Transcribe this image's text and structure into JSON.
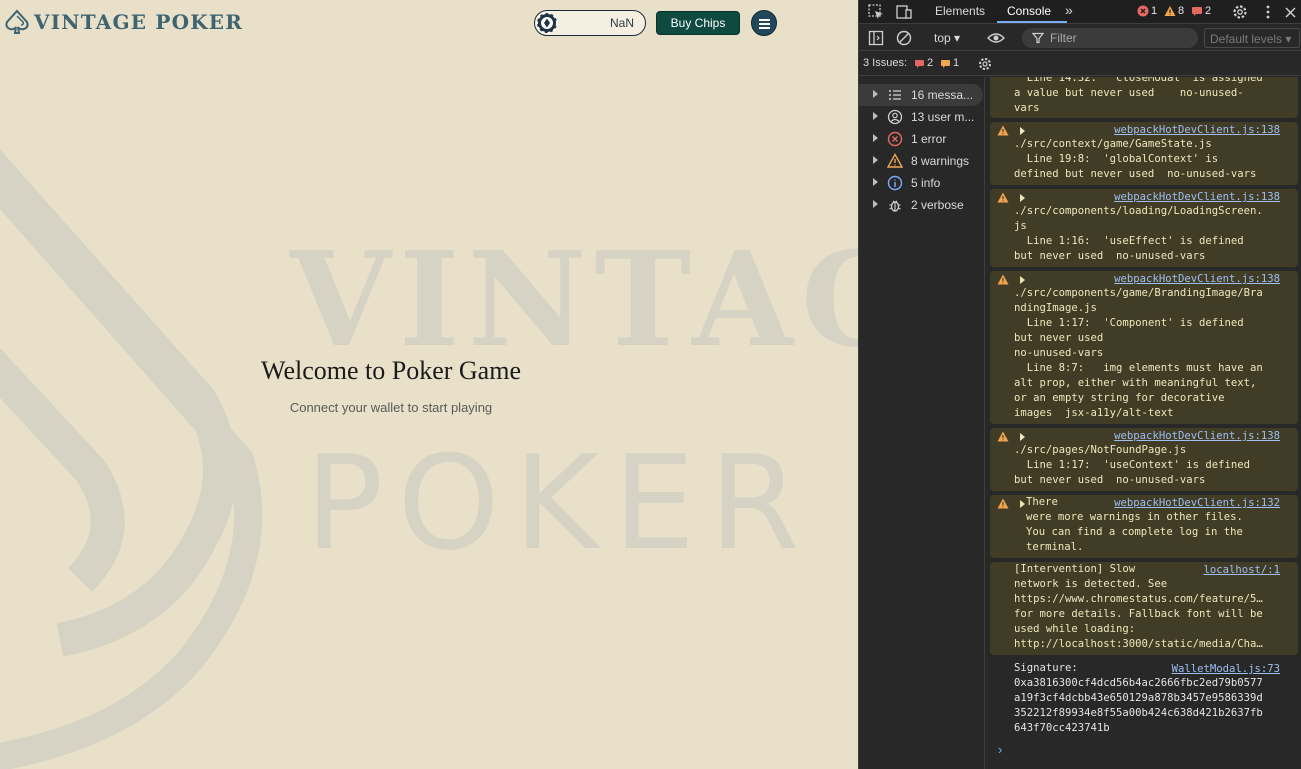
{
  "app": {
    "logo_text": "VINTAGE POKER",
    "balance": "NaN",
    "buy_chips": "Buy Chips",
    "welcome_title": "Welcome to Poker Game",
    "welcome_subtitle": "Connect your wallet to start playing",
    "watermark_line1": "VINTAGE",
    "watermark_line2": "POKER",
    "colors": {
      "background": "#e9e0ca",
      "brand": "#3e6470",
      "buy_button": "#0e4a3f",
      "menu_button": "#21485a"
    }
  },
  "devtools": {
    "tabs": {
      "elements": "Elements",
      "console": "Console",
      "more": "»"
    },
    "badges": {
      "errors": "1",
      "warnings": "8",
      "issues": "2"
    },
    "context": "top ▾",
    "filter_placeholder": "Filter",
    "levels": "Default levels ▾",
    "issues": {
      "label": "3 Issues:",
      "count_a": "2",
      "count_b": "1"
    },
    "sidebar": [
      {
        "label": "16 messa...",
        "icon": "list-icon"
      },
      {
        "label": "13 user m...",
        "icon": "user-icon"
      },
      {
        "label": "1 error",
        "icon": "error-icon"
      },
      {
        "label": "8 warnings",
        "icon": "warning-icon"
      },
      {
        "label": "5 info",
        "icon": "info-icon"
      },
      {
        "label": "2 verbose",
        "icon": "bug-icon"
      }
    ],
    "messages": [
      {
        "src": "",
        "text": "  Line 14:32:  'closeModal' is assigned\na value but never used    no-unused-\nvars"
      },
      {
        "src": "webpackHotDevClient.js:138",
        "text": "./src/context/game/GameState.js\n  Line 19:8:  'globalContext' is\ndefined but never used  no-unused-vars"
      },
      {
        "src": "webpackHotDevClient.js:138",
        "text": "./src/components/loading/LoadingScreen.\njs\n  Line 1:16:  'useEffect' is defined\nbut never used  no-unused-vars"
      },
      {
        "src": "webpackHotDevClient.js:138",
        "text": "./src/components/game/BrandingImage/Bra\nndingImage.js\n  Line 1:17:  'Component' is defined\nbut never used\nno-unused-vars\n  Line 8:7:   img elements must have an\nalt prop, either with meaningful text,\nor an empty string for decorative\nimages  jsx-a11y/alt-text"
      },
      {
        "src": "webpackHotDevClient.js:138",
        "text": "./src/pages/NotFoundPage.js\n  Line 1:17:  'useContext' is defined\nbut never used  no-unused-vars"
      },
      {
        "src": "webpackHotDevClient.js:132",
        "text": "There\nwere more warnings in other files.\nYou can find a complete log in the\nterminal."
      },
      {
        "src": "localhost/:1",
        "text": "[Intervention] Slow\nnetwork is detected. See\nhttps://www.chromestatus.com/feature/5…\nfor more details. Fallback font will be\nused while loading:\nhttp://localhost:3000/static/media/Cha…"
      },
      {
        "src": "WalletModal.js:73",
        "text": "Signature:\n0xa3816300cf4dcd56b4ac2666fbc2ed79b0577\na19f3cf4dcbb43e650129a878b3457e9586339d\n352212f89934e8f55a00b424c638d421b2637fb\n643f70cc423741b"
      }
    ],
    "prompt": "›"
  }
}
